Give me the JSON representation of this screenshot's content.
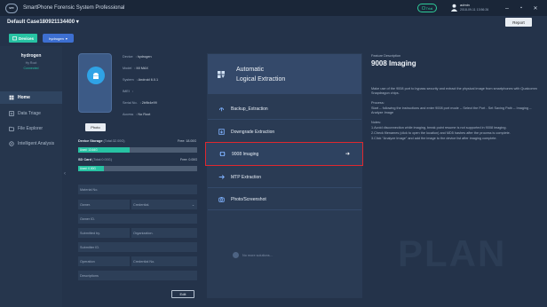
{
  "app": {
    "logo_text": "SPF",
    "title": "SmartPhone Forensic System Professional"
  },
  "header": {
    "trial_label": "Trial",
    "user_name": "admin",
    "user_time": "2018-09-11 13:56:26",
    "minimize": "–",
    "maximize": "▪",
    "close": "✕"
  },
  "case": {
    "title": "Default Case180921134400",
    "report_label": "Report"
  },
  "toolbar": {
    "devices_label": "Devices",
    "device_select": "hydrogen"
  },
  "sidebar": {
    "device_name": "hydrogen",
    "device_status_1": "Hy Root",
    "device_status_2": "Connected",
    "collapse_arrow": "‹",
    "items": [
      {
        "label": "Home",
        "active": true,
        "icon": "home-icon"
      },
      {
        "label": "Data Triage",
        "active": false,
        "icon": "triage-icon"
      },
      {
        "label": "File Explorer",
        "active": false,
        "icon": "folder-icon"
      },
      {
        "label": "Intelligent Analysis",
        "active": false,
        "icon": "analysis-icon"
      }
    ]
  },
  "device": {
    "photo_button": "Photo",
    "info": [
      {
        "label": "Device",
        "value": ": hydrogen"
      },
      {
        "label": "Model",
        "value": ": MI MAX"
      },
      {
        "label": "System",
        "value": ": Android 6.0.1"
      },
      {
        "label": "IMEI",
        "value": ":"
      },
      {
        "label": "Serial No.",
        "value": ": 2b9b4e99"
      },
      {
        "label": "Access",
        "value": ": No Root"
      }
    ],
    "storage": {
      "device_label": "Device Storage",
      "device_total": "(Total:32.00G)",
      "device_free": "Free: 18.00G",
      "device_used": "Used: 13.64G",
      "device_used_fraction": 0.43,
      "sd_label": "SD Card",
      "sd_total": "(Total:0.00G)",
      "sd_free": "Free: 0.00G",
      "sd_used": "Used: 0.00G",
      "sd_used_fraction": 0.0
    },
    "form": {
      "material_no": "Material No.",
      "owner": "Owner.",
      "credential": "Credential.",
      "owner_id": "Owner ID.",
      "submitted_by": "Submitted by.",
      "organization": "Organization.",
      "submitter_id": "Submitter ID.",
      "operation": "Operation",
      "credential_no": "Credential No.",
      "descriptions": "Descriptions"
    },
    "edit_button": "Edit"
  },
  "extraction": {
    "auto_line1": "Automatic",
    "auto_line2": "Logical Extraction",
    "items": [
      {
        "label": "Backup_Extraction",
        "icon": "backup-icon"
      },
      {
        "label": "Downgrade Extraction",
        "icon": "downgrade-icon"
      },
      {
        "label": "9008 Imaging",
        "icon": "chip-icon",
        "selected": true,
        "arrow": "➔"
      },
      {
        "label": "MTP Extraction",
        "icon": "mtp-icon"
      },
      {
        "label": "Photo/Screenshot",
        "icon": "camera-icon"
      }
    ],
    "more_text": "No more solutions..."
  },
  "feature": {
    "label": "Feature Description",
    "title": "9008 Imaging",
    "desc": "Make use of the 9008 port to bypass security and extract the physical image from smartphones with Qualcomm Snapdragon chips.",
    "process_head": "Process:",
    "process_text": "Start -- following the instructions and enter 9008 port mode -- Select the Port - Set Saving Path -- Imaging -- Analyze Image",
    "notes_head": "Notes:",
    "note1": "1.Avoid disconnection while imaging, break point resume is not supported in 9008 imaging.",
    "note2": "2.Check filenames (click to open the location) and MD5 hashes after the process is complete.",
    "note3": "3.Click \"Analyze Image\" and add the image to the device list after imaging complete."
  },
  "watermark": "PLAN",
  "colors": {
    "accent_teal": "#27c2a3",
    "accent_blue": "#3d6fd1",
    "selection_red": "#e0282e",
    "background": "#24334a"
  }
}
